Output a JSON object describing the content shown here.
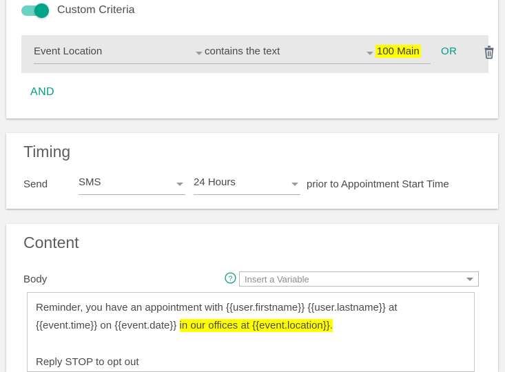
{
  "criteria_section": {
    "toggle_label": "Custom Criteria",
    "toggle_state": "on",
    "accent_color": "#009d86",
    "highlight_color": "#ffff00",
    "row": {
      "field_value": "Event Location",
      "operator_value": "contains the text",
      "text_value": "100 Main",
      "or_label": "OR",
      "delete_icon": "trash-icon"
    },
    "and_label": "AND"
  },
  "timing_section": {
    "title": "Timing",
    "send_label": "Send",
    "channel_value": "SMS",
    "offset_value": "24 Hours",
    "suffix_text": "prior to Appointment Start Time"
  },
  "content_section": {
    "title": "Content",
    "body_label": "Body",
    "help_icon": "help-circle-icon",
    "variable_placeholder": "Insert a Variable",
    "body_line_1": "Reminder, you have an appointment with {{user.firstname}} {{user.lastname}} at",
    "body_line_2_plain": "{{event.time}} on {{event.date}} ",
    "body_line_2_highlight": "in our offices at {{event.location}}.",
    "body_line_3": "Reply STOP to opt out"
  }
}
